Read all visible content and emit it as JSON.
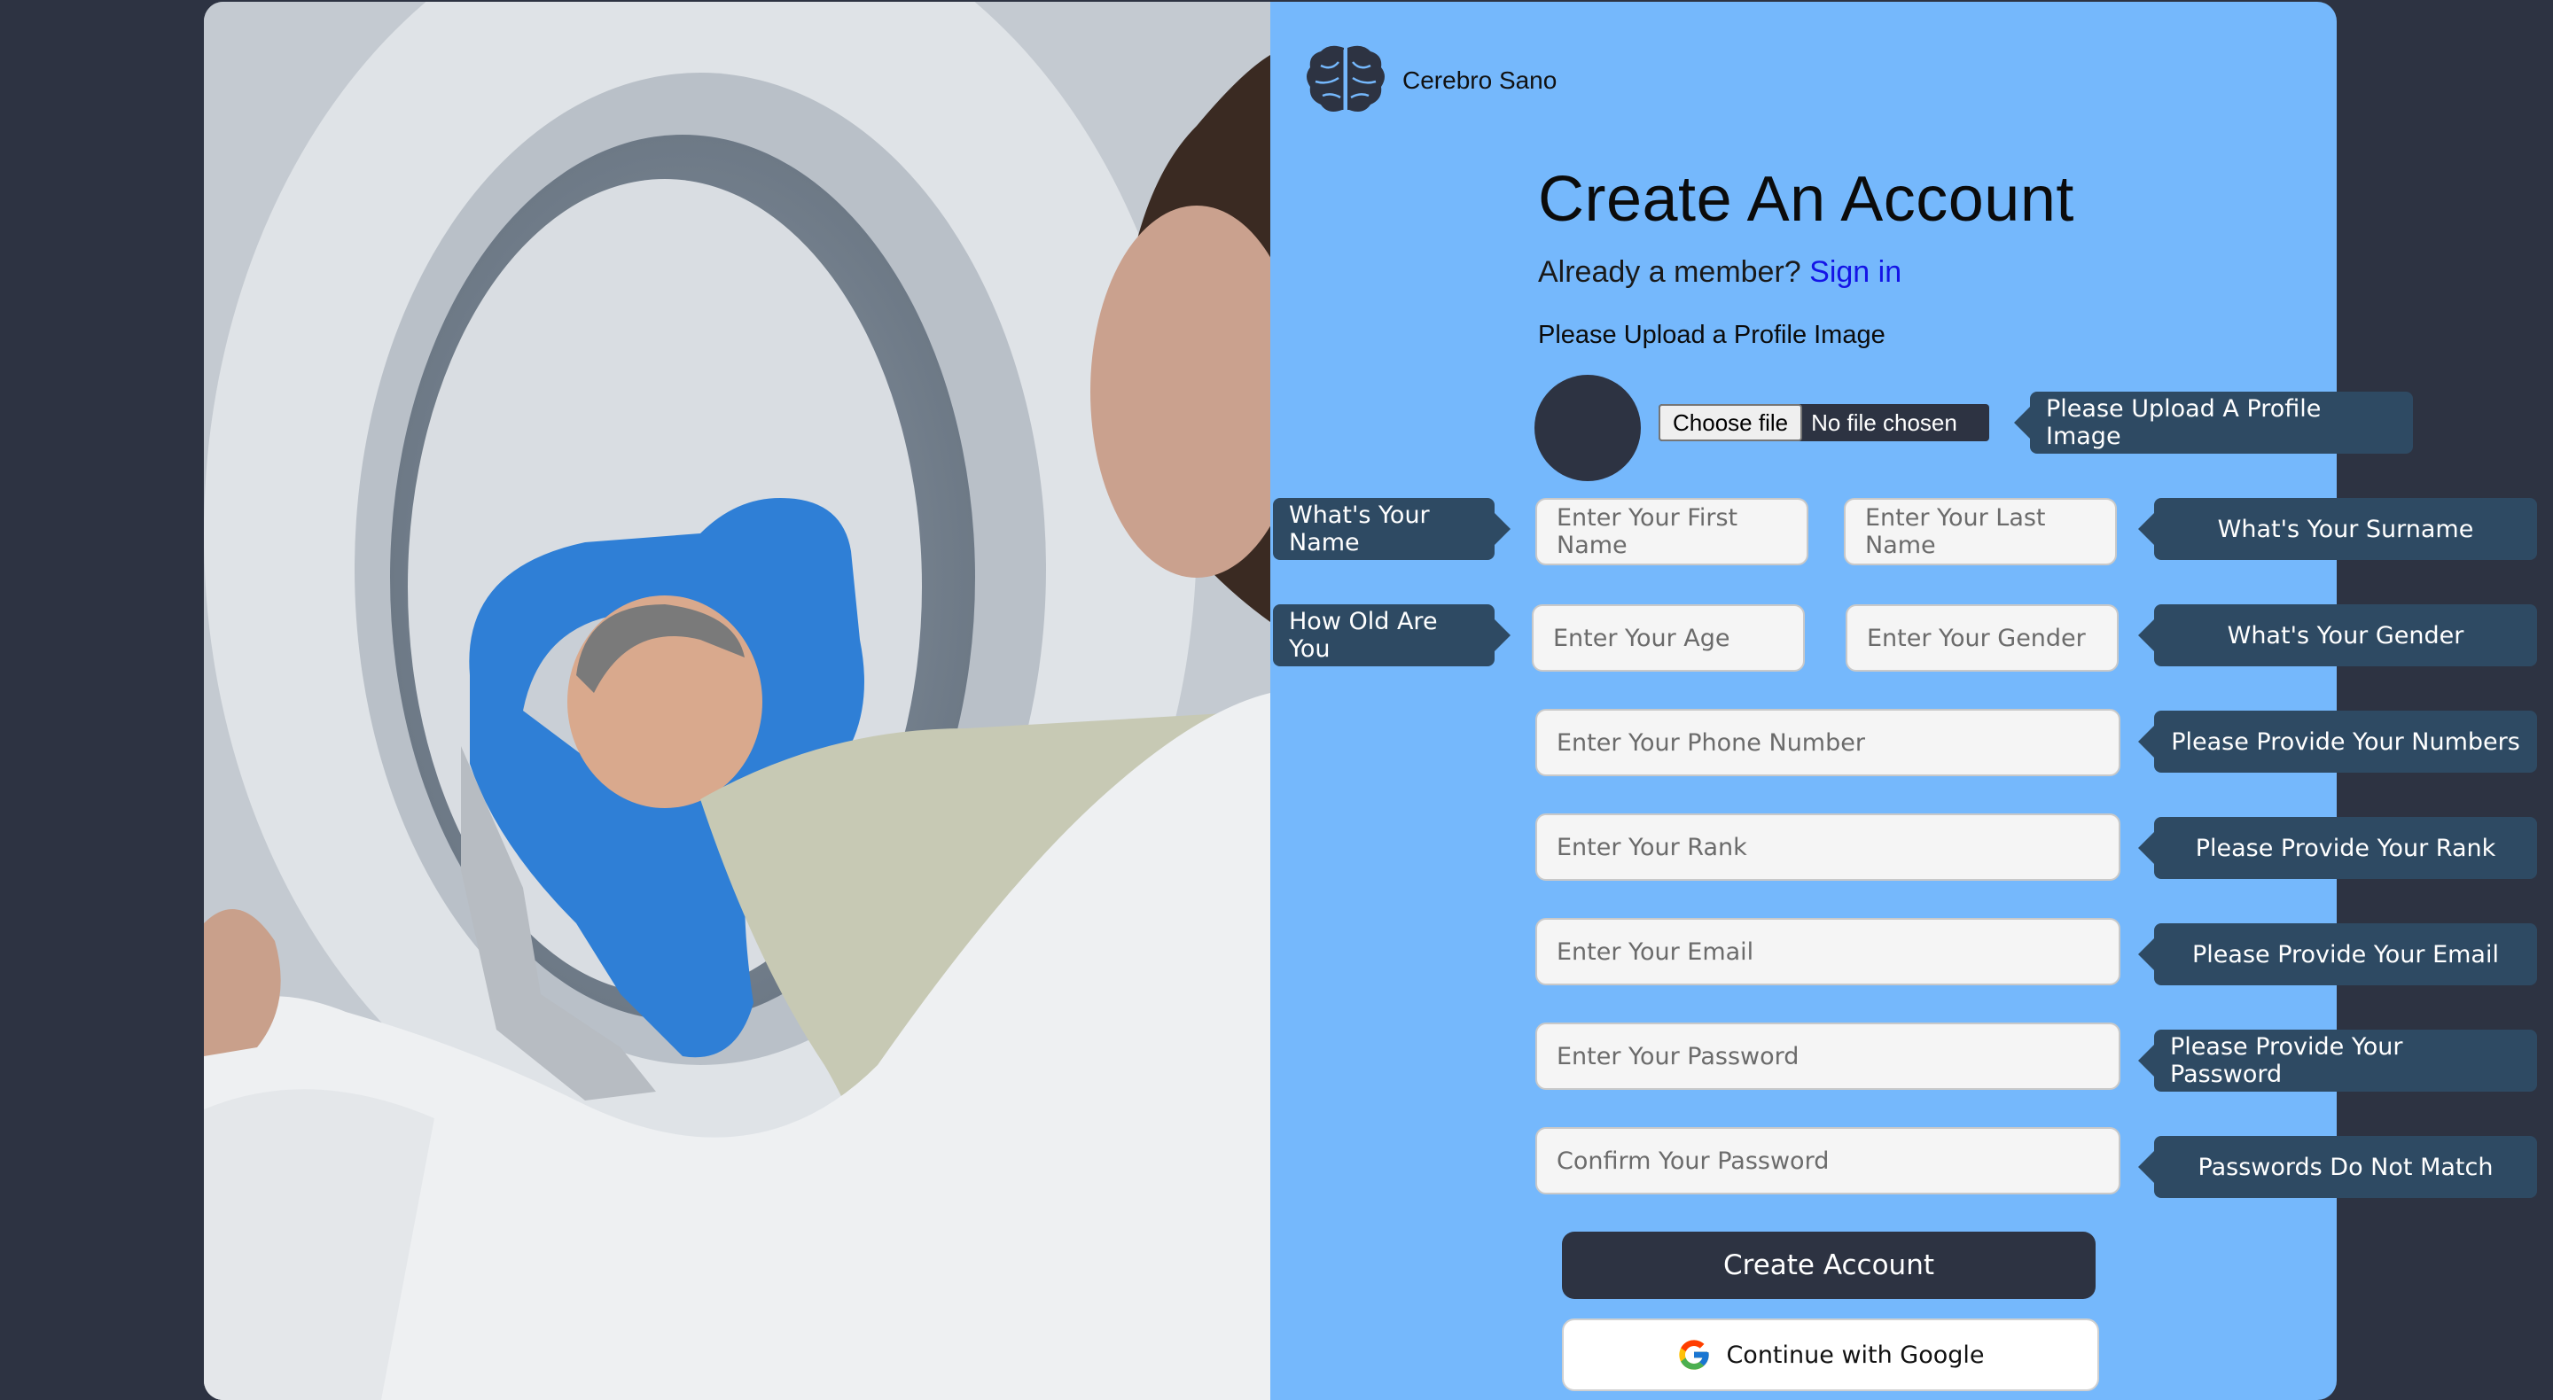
{
  "brand": {
    "name": "Cerebro Sano",
    "logo_icon": "brain-icon"
  },
  "heading": "Create An Account",
  "member_prompt": "Already a member?",
  "sign_in_link": "Sign in",
  "upload": {
    "label": "Please Upload a Profile Image",
    "choose_button": "Choose file",
    "status": "No file chosen",
    "tooltip": "Please Upload A Profile Image"
  },
  "fields": {
    "first_name": {
      "placeholder": "Enter Your First Name"
    },
    "last_name": {
      "placeholder": "Enter Your Last Name"
    },
    "age": {
      "placeholder": "Enter Your Age"
    },
    "gender": {
      "placeholder": "Enter Your Gender"
    },
    "phone": {
      "placeholder": "Enter Your Phone Number"
    },
    "rank": {
      "placeholder": "Enter Your Rank"
    },
    "email": {
      "placeholder": "Enter Your Email"
    },
    "password": {
      "placeholder": "Enter Your Password"
    },
    "confirm_password": {
      "placeholder": "Confirm Your Password"
    }
  },
  "tooltips": {
    "name": "What's Your Name",
    "surname": "What's Your Surname",
    "age": "How Old Are You",
    "gender": "What's Your Gender",
    "phone": "Please Provide Your Numbers",
    "rank": "Please Provide Your Rank",
    "email": "Please Provide Your Email",
    "password": "Please Provide Your Password",
    "confirm_password": "Passwords Do Not Match"
  },
  "buttons": {
    "create": "Create Account",
    "google": "Continue with Google"
  },
  "colors": {
    "page_bg": "#2d3342",
    "form_bg": "#75b8fc",
    "tooltip_bg": "#2e4a63",
    "link": "#1414e6"
  }
}
